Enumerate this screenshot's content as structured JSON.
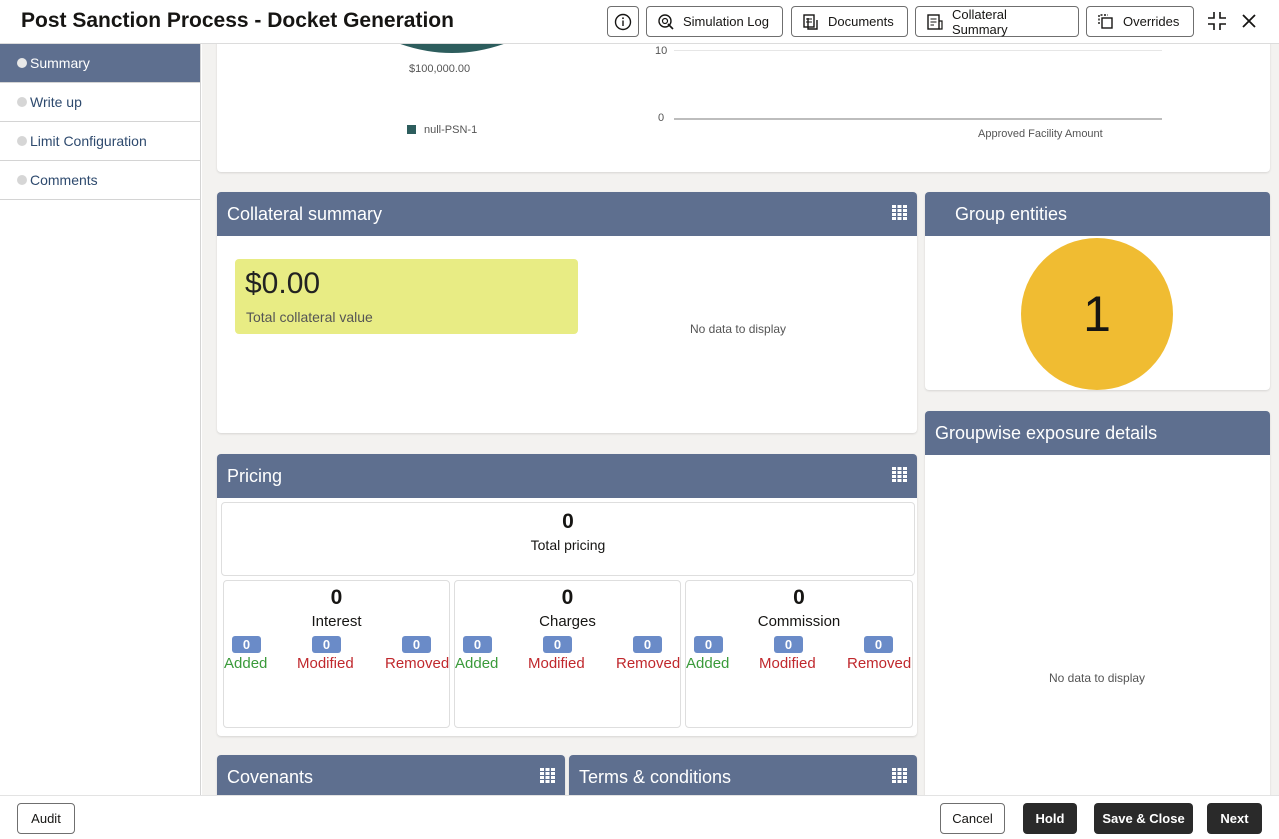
{
  "header": {
    "title": "Post Sanction Process - Docket Generation",
    "buttons": {
      "simulation_log": "Simulation Log",
      "documents": "Documents",
      "collateral_summary": "Collateral Summary",
      "overrides": "Overrides"
    }
  },
  "sidebar": {
    "items": [
      {
        "label": "Summary",
        "active": true
      },
      {
        "label": "Write up"
      },
      {
        "label": "Limit Configuration"
      },
      {
        "label": "Comments"
      }
    ]
  },
  "top_charts": {
    "pie_value_label": "$100,000.00",
    "pie_legend": "null-PSN-1",
    "bar_ticks": [
      "10",
      "0"
    ],
    "bar_xlabel": "Approved Facility Amount"
  },
  "collateral_summary": {
    "title": "Collateral summary",
    "value": "$0.00",
    "value_label": "Total collateral value",
    "no_data": "No data to display"
  },
  "group_entities": {
    "title": "Group entities",
    "count": "1"
  },
  "groupwise_exposure": {
    "title": "Groupwise exposure details",
    "no_data": "No data to display"
  },
  "pricing": {
    "title": "Pricing",
    "total_value": "0",
    "total_label": "Total pricing",
    "groups": [
      {
        "value": "0",
        "label": "Interest",
        "added": "0",
        "modified": "0",
        "removed": "0"
      },
      {
        "value": "0",
        "label": "Charges",
        "added": "0",
        "modified": "0",
        "removed": "0"
      },
      {
        "value": "0",
        "label": "Commission",
        "added": "0",
        "modified": "0",
        "removed": "0"
      }
    ],
    "stat_labels": {
      "added": "Added",
      "modified": "Modified",
      "removed": "Removed"
    }
  },
  "covenants": {
    "title": "Covenants"
  },
  "terms": {
    "title": "Terms & conditions"
  },
  "footer": {
    "audit": "Audit",
    "cancel": "Cancel",
    "hold": "Hold",
    "save_close": "Save & Close",
    "next": "Next"
  },
  "colors": {
    "header_panel": "#5e6f8f",
    "collateral_box": "#e8ec84",
    "group_circle": "#f0bc32",
    "badge": "#6a8bc8",
    "added": "#3a9a3a",
    "modified_removed": "#c0282d",
    "pie_slice": "#2d5d5d"
  },
  "icons": [
    "info-icon",
    "simulation-log-icon",
    "documents-icon",
    "collateral-summary-icon",
    "overrides-icon",
    "collapse-icon",
    "close-icon",
    "grid-view-icon"
  ]
}
